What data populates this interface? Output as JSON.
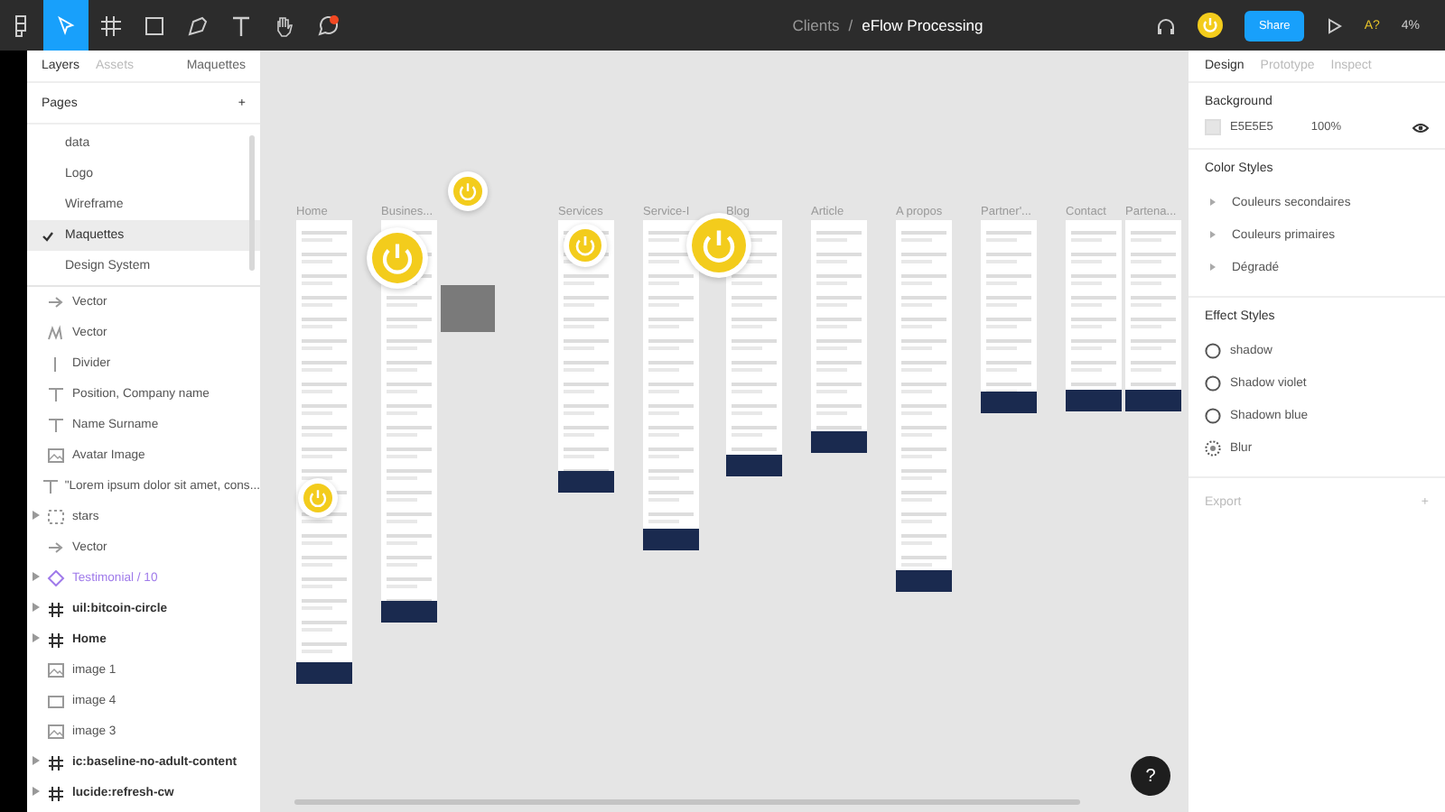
{
  "toolbar": {
    "breadcrumb": {
      "parent": "Clients",
      "separator": "/",
      "file": "eFlow Processing"
    },
    "share": "Share",
    "accessibility": "A?",
    "zoom": "4%"
  },
  "left_panel": {
    "tabs": [
      {
        "label": "Layers",
        "selected": true
      },
      {
        "label": "Assets",
        "selected": false
      }
    ],
    "page_dropdown": "Maquettes",
    "pages_heading": "Pages",
    "add": "+",
    "pages": [
      {
        "label": "data",
        "selected": false
      },
      {
        "label": "Logo",
        "selected": false
      },
      {
        "label": "Wireframe",
        "selected": false
      },
      {
        "label": "Maquettes",
        "selected": true
      },
      {
        "label": "Design System",
        "selected": false
      }
    ],
    "layers": [
      {
        "kind": "arrow",
        "label": "Vector",
        "expandable": false
      },
      {
        "kind": "vector",
        "label": "Vector",
        "expandable": false
      },
      {
        "kind": "line",
        "label": "Divider",
        "expandable": false
      },
      {
        "kind": "text",
        "label": "Position, Company name",
        "expandable": false
      },
      {
        "kind": "text",
        "label": "Name Surname",
        "expandable": false
      },
      {
        "kind": "image",
        "label": "Avatar Image",
        "expandable": false
      },
      {
        "kind": "text",
        "label": "\"Lorem ipsum dolor sit amet, cons...",
        "expandable": false
      },
      {
        "kind": "group",
        "label": "stars",
        "expandable": true
      },
      {
        "kind": "arrow",
        "label": "Vector",
        "expandable": false
      },
      {
        "kind": "component",
        "label": "Testimonial / 10",
        "expandable": true
      },
      {
        "kind": "frame",
        "label": "uil:bitcoin-circle",
        "expandable": true
      },
      {
        "kind": "frame",
        "label": "Home",
        "expandable": true
      },
      {
        "kind": "image",
        "label": "image 1",
        "expandable": false
      },
      {
        "kind": "rect",
        "label": "image 4",
        "expandable": false
      },
      {
        "kind": "image",
        "label": "image 3",
        "expandable": false
      },
      {
        "kind": "frame",
        "label": "ic:baseline-no-adult-content",
        "expandable": true
      },
      {
        "kind": "frame",
        "label": "lucide:refresh-cw",
        "expandable": true
      }
    ]
  },
  "canvas": {
    "frames": [
      {
        "label": "Home"
      },
      {
        "label": "Busines..."
      },
      {
        "label": "Services"
      },
      {
        "label": "Service-I"
      },
      {
        "label": "Blog"
      },
      {
        "label": "Article"
      },
      {
        "label": "A propos"
      },
      {
        "label": "Partner'..."
      },
      {
        "label": "Contact"
      },
      {
        "label": "Partena..."
      }
    ]
  },
  "right_panel": {
    "tabs": [
      {
        "label": "Design",
        "selected": true
      },
      {
        "label": "Prototype",
        "selected": false
      },
      {
        "label": "Inspect",
        "selected": false
      }
    ],
    "background": {
      "heading": "Background",
      "color": "#e5e5e5",
      "hex": "E5E5E5",
      "opacity": "100%"
    },
    "color_styles": {
      "heading": "Color Styles",
      "items": [
        "Couleurs secondaires",
        "Couleurs primaires",
        "Dégradé"
      ]
    },
    "effect_styles": {
      "heading": "Effect Styles",
      "items": [
        {
          "kind": "shadow",
          "label": "shadow"
        },
        {
          "kind": "shadow",
          "label": "Shadow violet"
        },
        {
          "kind": "shadow",
          "label": "Shadown blue"
        },
        {
          "kind": "blur",
          "label": "Blur"
        }
      ]
    },
    "export": {
      "heading": "Export",
      "add": "+"
    }
  },
  "help": "?"
}
